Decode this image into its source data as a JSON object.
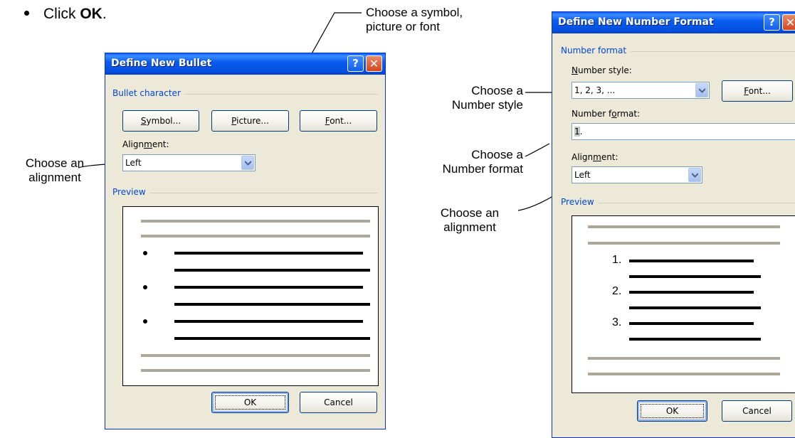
{
  "instruction": {
    "prefix": "Click ",
    "bold": "OK",
    "suffix": "."
  },
  "callouts": {
    "symbol_line1": "Choose a symbol,",
    "symbol_line2": "picture or font",
    "alignment_left_line1": "Choose an",
    "alignment_left_line2": "alignment",
    "number_style_line1": "Choose a",
    "number_style_line2": "Number style",
    "number_format_line1": "Choose a",
    "number_format_line2": "Number format",
    "alignment_right_line1": "Choose an",
    "alignment_right_line2": "alignment"
  },
  "bullet_dialog": {
    "title": "Define New Bullet",
    "help_glyph": "?",
    "close_glyph": "✕",
    "group_bullet_character": "Bullet character",
    "symbol_button": {
      "mnemonic": "S",
      "rest": "ymbol..."
    },
    "picture_button": {
      "mnemonic": "P",
      "rest": "icture..."
    },
    "font_button": {
      "mnemonic": "F",
      "rest": "ont..."
    },
    "alignment_label": {
      "pre": "Align",
      "mnemonic": "m",
      "post": "ent:"
    },
    "alignment_value": "Left",
    "group_preview": "Preview",
    "ok_button": "OK",
    "cancel_button": "Cancel"
  },
  "number_dialog": {
    "title": "Define New Number Format",
    "help_glyph": "?",
    "close_glyph": "✕",
    "group_number_format": "Number format",
    "number_style_label": {
      "mnemonic": "N",
      "rest": "umber style:"
    },
    "number_style_value": "1, 2, 3, ...",
    "font_button": {
      "mnemonic": "F",
      "rest": "ont..."
    },
    "number_format_label": {
      "pre": "Number f",
      "mnemonic": "o",
      "post": "rmat:"
    },
    "number_format_value_selected": "1",
    "number_format_value_rest": ".",
    "alignment_label": {
      "pre": "Align",
      "mnemonic": "m",
      "post": "ent:"
    },
    "alignment_value": "Left",
    "group_preview": "Preview",
    "preview_numbers": [
      "1.",
      "2.",
      "3."
    ],
    "ok_button": "OK",
    "cancel_button": "Cancel"
  },
  "colors": {
    "titlebar": "#0a5cf0",
    "dialog_face": "#ece9d8",
    "group_label": "#0046d5",
    "preview_gray_bar": "#aca899"
  }
}
